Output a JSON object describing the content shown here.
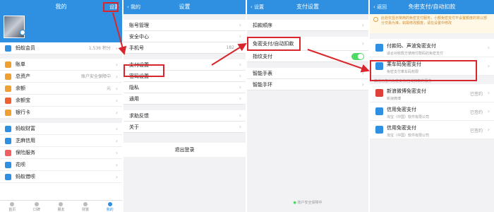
{
  "panel1": {
    "title": "我的",
    "settings": "设置",
    "member": {
      "label": "蚂蚁会员",
      "points": "1,536 积分"
    },
    "group1": [
      {
        "label": "账单",
        "value": "",
        "color": "#f0a030"
      },
      {
        "label": "总资产",
        "value": "账户安全保障中",
        "color": "#f0a030"
      },
      {
        "label": "余额",
        "value": "元",
        "color": "#f0a030"
      },
      {
        "label": "余额宝",
        "value": "",
        "color": "#f06030"
      },
      {
        "label": "银行卡",
        "value": "",
        "color": "#f0a030"
      }
    ],
    "group2": [
      {
        "label": "蚂蚁财富",
        "value": "",
        "color": "#2f8fe0"
      },
      {
        "label": "芝麻信用",
        "value": "",
        "color": "#2f8fe0"
      },
      {
        "label": "保险服务",
        "value": "",
        "color": "#f06060"
      },
      {
        "label": "花呗",
        "value": "",
        "color": "#2f8fe0"
      },
      {
        "label": "蚂蚁借呗",
        "value": "",
        "color": "#2f8fe0"
      }
    ],
    "tabs": [
      "首页",
      "口碑",
      "朋友",
      "财富",
      "我的"
    ]
  },
  "panel2": {
    "back": "我的",
    "title": "设置",
    "group1": [
      "账号管理",
      "安全中心",
      "手机号"
    ],
    "phone_value": "182",
    "group2": [
      "支付设置",
      "密码设置",
      "隐私",
      "通用"
    ],
    "group3": [
      "求助反馈",
      "关于"
    ],
    "logout": "退出登录"
  },
  "panel3": {
    "back": "设置",
    "title": "支付设置",
    "items": [
      "扣款顺序",
      "免密支付/自动扣款",
      "指纹支付",
      "智能手表",
      "智能手环"
    ],
    "footer": "账户安全保障中"
  },
  "panel4": {
    "back": "返回",
    "title": "免密支付/自动扣款",
    "notice": "此处仅显示常用的免密支付服务，小额免密支付不设置额度的将以部分交易为准，如需修改额度，请在设置中修改",
    "cards": [
      {
        "title": "付款码、声波免密支付",
        "sub": "适合对收款方使用付款码的免密支付",
        "status": ""
      },
      {
        "title": "乘车码免密支付",
        "sub": "免密支付乘车码权限",
        "status": ""
      }
    ],
    "section": "其他已签约免密支付/自动扣款的服务",
    "services": [
      {
        "title": "新浪微博免密支付",
        "sub": "新浪微博",
        "status": "已签约"
      },
      {
        "title": "信用免密支付",
        "sub": "淘宝（中国）软件有限公司",
        "status": "已签约"
      },
      {
        "title": "信用免密支付",
        "sub": "淘宝（中国）软件有限公司",
        "status": "已签约"
      }
    ]
  }
}
